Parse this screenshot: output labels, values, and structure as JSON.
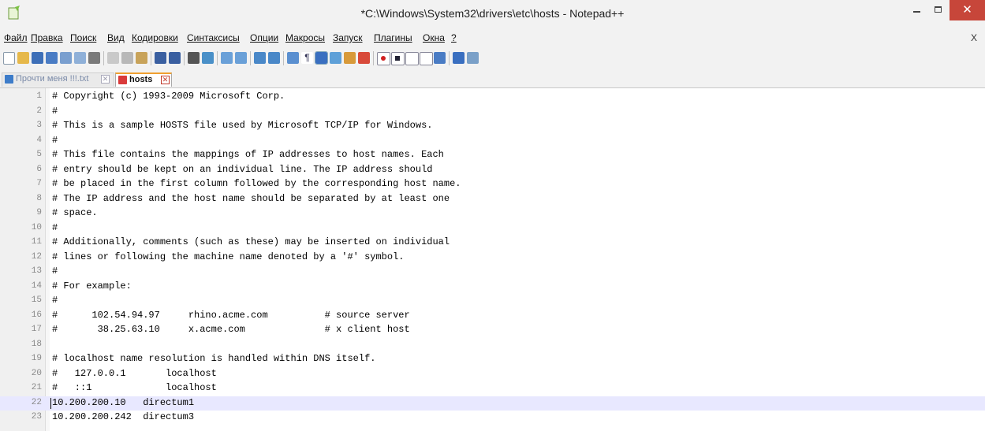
{
  "window": {
    "title": "*C:\\Windows\\System32\\drivers\\etc\\hosts - Notepad++",
    "minimize_icon": "minimize-icon",
    "maximize_icon": "maximize-icon",
    "close_glyph": "✕"
  },
  "menu": {
    "items": [
      "Файл",
      "Правка",
      "Поиск",
      "Вид",
      "Кодировки",
      "Синтаксисы",
      "Опции",
      "Макросы",
      "Запуск",
      "Плагины",
      "Окна",
      "?"
    ],
    "close_label": "X"
  },
  "toolbar": {
    "icons": [
      "new-file-icon",
      "open-file-icon",
      "save-icon",
      "save-all-icon",
      "close-icon",
      "close-all-icon",
      "print-icon",
      "cut-icon",
      "copy-icon",
      "paste-icon",
      "undo-icon",
      "redo-icon",
      "find-icon",
      "replace-icon",
      "zoom-in-icon",
      "zoom-out-icon",
      "sync-vertical-icon",
      "sync-horizontal-icon",
      "word-wrap-icon",
      "show-all-chars-icon",
      "indent-guide-icon",
      "doc-map-icon",
      "function-list-icon",
      "folder-workspace-icon",
      "record-macro-icon",
      "stop-macro-icon",
      "play-macro-icon",
      "run-macro-multiple-icon",
      "save-macro-icon",
      "spell-check-icon",
      "spell-check-options-icon"
    ]
  },
  "tabs": [
    {
      "label": "Прочти меня !!!.txt",
      "active": false
    },
    {
      "label": "hosts",
      "active": true
    }
  ],
  "tab_close_glyph": "✕",
  "editor": {
    "current_line": 22,
    "lines": [
      "# Copyright (c) 1993-2009 Microsoft Corp.",
      "#",
      "# This is a sample HOSTS file used by Microsoft TCP/IP for Windows.",
      "#",
      "# This file contains the mappings of IP addresses to host names. Each",
      "# entry should be kept on an individual line. The IP address should",
      "# be placed in the first column followed by the corresponding host name.",
      "# The IP address and the host name should be separated by at least one",
      "# space.",
      "#",
      "# Additionally, comments (such as these) may be inserted on individual",
      "# lines or following the machine name denoted by a '#' symbol.",
      "#",
      "# For example:",
      "#",
      "#      102.54.94.97     rhino.acme.com          # source server",
      "#       38.25.63.10     x.acme.com              # x client host",
      "",
      "# localhost name resolution is handled within DNS itself.",
      "#   127.0.0.1       localhost",
      "#   ::1             localhost",
      "10.200.200.10   directum1",
      "10.200.200.242  directum3"
    ],
    "line_numbers": [
      "1",
      "2",
      "3",
      "4",
      "5",
      "6",
      "7",
      "8",
      "9",
      "10",
      "11",
      "12",
      "13",
      "14",
      "15",
      "16",
      "17",
      "18",
      "19",
      "20",
      "21",
      "22",
      "23"
    ]
  }
}
